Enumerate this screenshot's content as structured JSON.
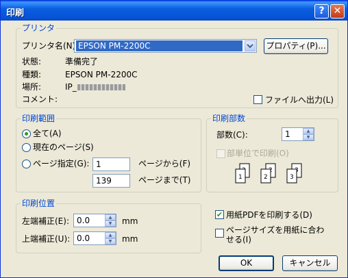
{
  "window": {
    "title": "印刷",
    "help_glyph": "?",
    "close_glyph": "✕"
  },
  "printer": {
    "group_label": "プリンタ",
    "name_label": "プリンタ名(N):",
    "name_value": "EPSON PM-2200C",
    "properties_button": "プロパティ(P)...",
    "status_label": "状態:",
    "status_value": "準備完了",
    "type_label": "種類:",
    "type_value": "EPSON PM-2200C",
    "location_label": "場所:",
    "location_value": "IP_",
    "comment_label": "コメント:",
    "print_to_file": "ファイルへ出力(L)",
    "print_to_file_checked": false
  },
  "range": {
    "group_label": "印刷範囲",
    "all": "全て(A)",
    "current": "現在のページ(S)",
    "pages": "ページ指定(G):",
    "from_value": "1",
    "from_suffix": "ページから(F)",
    "to_value": "139",
    "to_suffix": "ページまで(T)",
    "selected": "all"
  },
  "copies": {
    "group_label": "印刷部数",
    "count_label": "部数(C):",
    "count_value": "1",
    "collate": "部単位で印刷(O)",
    "collate_enabled": false
  },
  "position": {
    "group_label": "印刷位置",
    "left_label": "左端補正(E):",
    "left_value": "0.0",
    "top_label": "上端補正(U):",
    "top_value": "0.0",
    "unit": "mm"
  },
  "options": {
    "pdf_paper": "用紙PDFを印刷する(D)",
    "pdf_paper_checked": true,
    "fit_line1": "ページサイズを用紙に合わ",
    "fit_line2": "せる(I)",
    "fit_checked": false
  },
  "buttons": {
    "ok": "OK",
    "cancel": "キャンセル"
  },
  "colors": {
    "title_bar": "#0a5fe0",
    "dialog_bg": "#ece9d8",
    "group_label": "#0046d5",
    "selection": "#316ac5"
  }
}
